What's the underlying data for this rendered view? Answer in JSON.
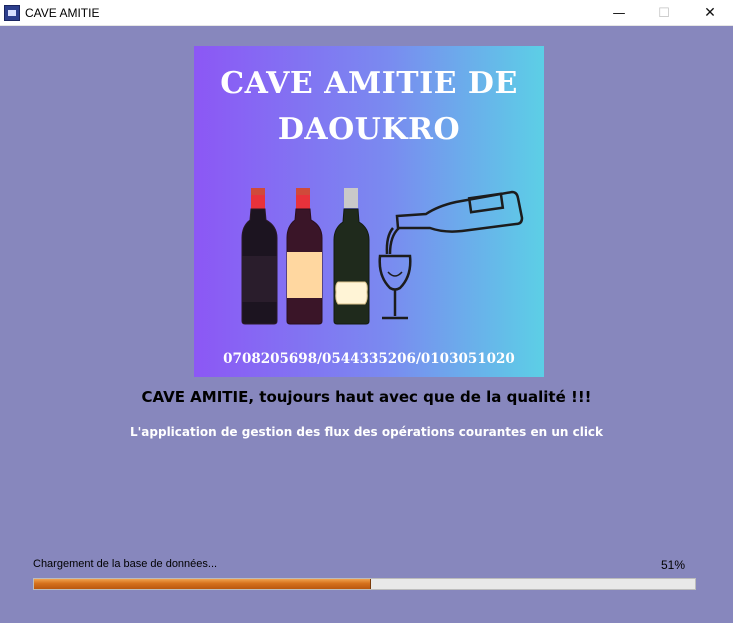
{
  "window": {
    "title": "CAVE AMITIE",
    "controls": {
      "minimize": "—",
      "maximize": "☐",
      "close": "✕"
    }
  },
  "logo": {
    "line1": "CAVE AMITIE DE",
    "line2": "DAOUKRO",
    "phones": "0708205698/0544335206/0103051020"
  },
  "slogan": "CAVE AMITIE, toujours haut avec que de la qualité !!!",
  "subtitle": "L'application de gestion des flux des opérations courantes en un click",
  "progress": {
    "status": "Chargement de la base de données...",
    "percent_label": "51%",
    "value": 0.51
  },
  "colors": {
    "background": "#8787bd",
    "progress_fill": "#d5701c",
    "logo_gradient_start": "#8c57f5",
    "logo_gradient_end": "#5ccfe6"
  }
}
